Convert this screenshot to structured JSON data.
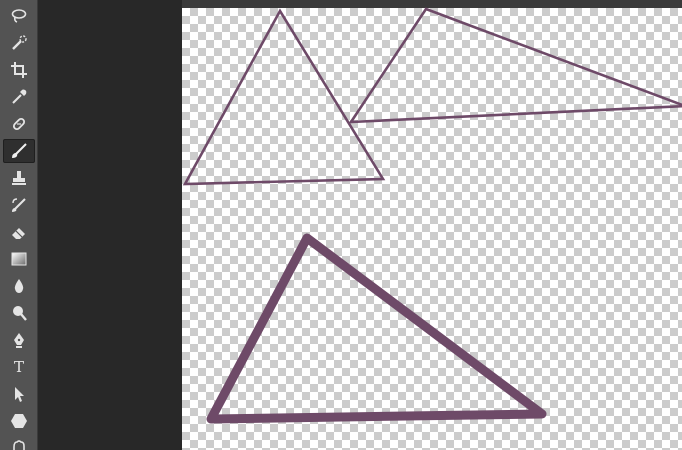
{
  "toolbar": {
    "tools": [
      {
        "name": "lasso-icon",
        "active": false
      },
      {
        "name": "quick-selection-icon",
        "active": false
      },
      {
        "name": "crop-icon",
        "active": false
      },
      {
        "name": "eyedropper-icon",
        "active": false
      },
      {
        "name": "healing-brush-icon",
        "active": false
      },
      {
        "name": "brush-icon",
        "active": true
      },
      {
        "name": "clone-stamp-icon",
        "active": false
      },
      {
        "name": "history-brush-icon",
        "active": false
      },
      {
        "name": "eraser-icon",
        "active": false
      },
      {
        "name": "gradient-icon",
        "active": false
      },
      {
        "name": "blur-icon",
        "active": false
      },
      {
        "name": "dodge-icon",
        "active": false
      },
      {
        "name": "pen-icon",
        "active": false
      },
      {
        "name": "type-icon",
        "active": false,
        "glyph": "T"
      },
      {
        "name": "path-selection-icon",
        "active": false
      },
      {
        "name": "shape-icon",
        "active": false
      },
      {
        "name": "hand-icon",
        "active": false
      }
    ]
  },
  "canvas": {
    "stroke_color": "#6e4a68"
  },
  "colors": {
    "toolbar_bg": "#535353",
    "workspace_bg": "#282828",
    "stroke": "#6e4a68"
  }
}
